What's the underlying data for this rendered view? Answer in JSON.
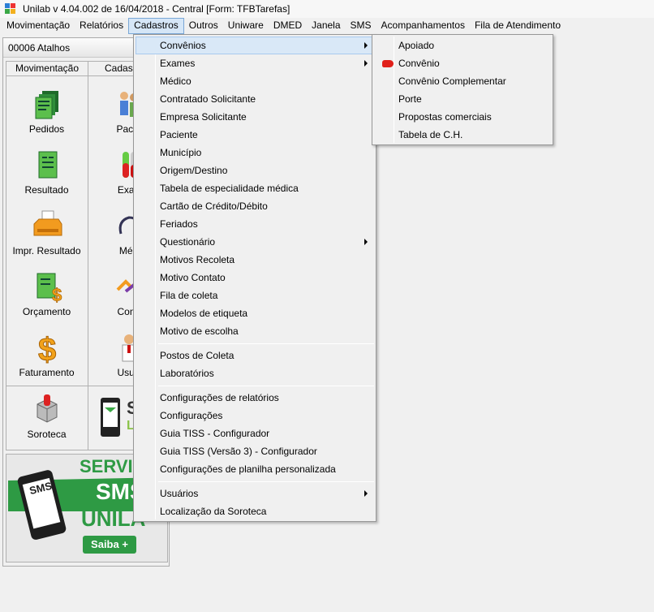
{
  "window": {
    "title": "Unilab v 4.04.002 de 16/04/2018 - Central  [Form: TFBTarefas]"
  },
  "menubar": [
    {
      "label": "Movimentação"
    },
    {
      "label": "Relatórios"
    },
    {
      "label": "Cadastros"
    },
    {
      "label": "Outros"
    },
    {
      "label": "Uniware"
    },
    {
      "label": "DMED"
    },
    {
      "label": "Janela"
    },
    {
      "label": "SMS"
    },
    {
      "label": "Acompanhamentos"
    },
    {
      "label": "Fila de Atendimento"
    }
  ],
  "panel": {
    "title": "00006 Atalhos",
    "columns": [
      "Movimentação",
      "Cadas"
    ],
    "left_items": [
      {
        "label": "Pedidos",
        "icon": "pedidos-icon"
      },
      {
        "label": "Resultado",
        "icon": "resultado-icon"
      },
      {
        "label": "Impr. Resultado",
        "icon": "printer-icon"
      },
      {
        "label": "Orçamento",
        "icon": "orcamento-icon"
      },
      {
        "label": "Faturamento",
        "icon": "dollar-icon"
      }
    ],
    "right_items": [
      {
        "label": "Pacie",
        "icon": "paciente-icon"
      },
      {
        "label": "Exan",
        "icon": "exames-icon"
      },
      {
        "label": "Méd",
        "icon": "medico-icon"
      },
      {
        "label": "Conv",
        "icon": "convenio-icon"
      },
      {
        "label": "Usuá",
        "icon": "usuario-icon"
      }
    ],
    "soroteca": {
      "label": "Soroteca"
    },
    "sms_banner": {
      "letters": "S",
      "letters2": "LI"
    },
    "ad": {
      "line1": "SERVIÇ",
      "line2": "SMS",
      "line3": "UNILA",
      "phone_text": "SMS",
      "cta": "Saiba +"
    }
  },
  "cadastros_menu": {
    "items": [
      {
        "label": "Convênios",
        "submenu": true,
        "highlighted": true
      },
      {
        "label": "Exames",
        "submenu": true
      },
      {
        "label": "Médico"
      },
      {
        "label": "Contratado Solicitante"
      },
      {
        "label": "Empresa Solicitante"
      },
      {
        "label": "Paciente"
      },
      {
        "label": "Município"
      },
      {
        "label": "Origem/Destino"
      },
      {
        "label": "Tabela de especialidade médica"
      },
      {
        "label": "Cartão de Crédito/Débito"
      },
      {
        "label": "Feriados"
      },
      {
        "label": "Questionário",
        "submenu": true
      },
      {
        "label": "Motivos Recoleta"
      },
      {
        "label": "Motivo Contato"
      },
      {
        "label": "Fila de coleta"
      },
      {
        "label": "Modelos de etiqueta"
      },
      {
        "label": "Motivo de escolha"
      },
      {
        "label": "Postos de Coleta"
      },
      {
        "label": "Laboratórios"
      },
      {
        "label": "Configurações de relatórios"
      },
      {
        "label": "Configurações"
      },
      {
        "label": "Guia TISS - Configurador"
      },
      {
        "label": "Guia TISS (Versão 3) - Configurador"
      },
      {
        "label": "Configurações de planilha personalizada"
      },
      {
        "label": "Usuários",
        "submenu": true
      },
      {
        "label": "Localização da Soroteca"
      }
    ]
  },
  "convenios_submenu": {
    "items": [
      {
        "label": "Apoiado"
      },
      {
        "label": "Convênio",
        "icon": "red-car-icon"
      },
      {
        "label": "Convênio Complementar"
      },
      {
        "label": "Porte"
      },
      {
        "label": "Propostas comerciais"
      },
      {
        "label": "Tabela de C.H."
      }
    ]
  },
  "colors": {
    "menu_highlight": "#d9e8f7",
    "ad_green": "#2e9a44"
  }
}
